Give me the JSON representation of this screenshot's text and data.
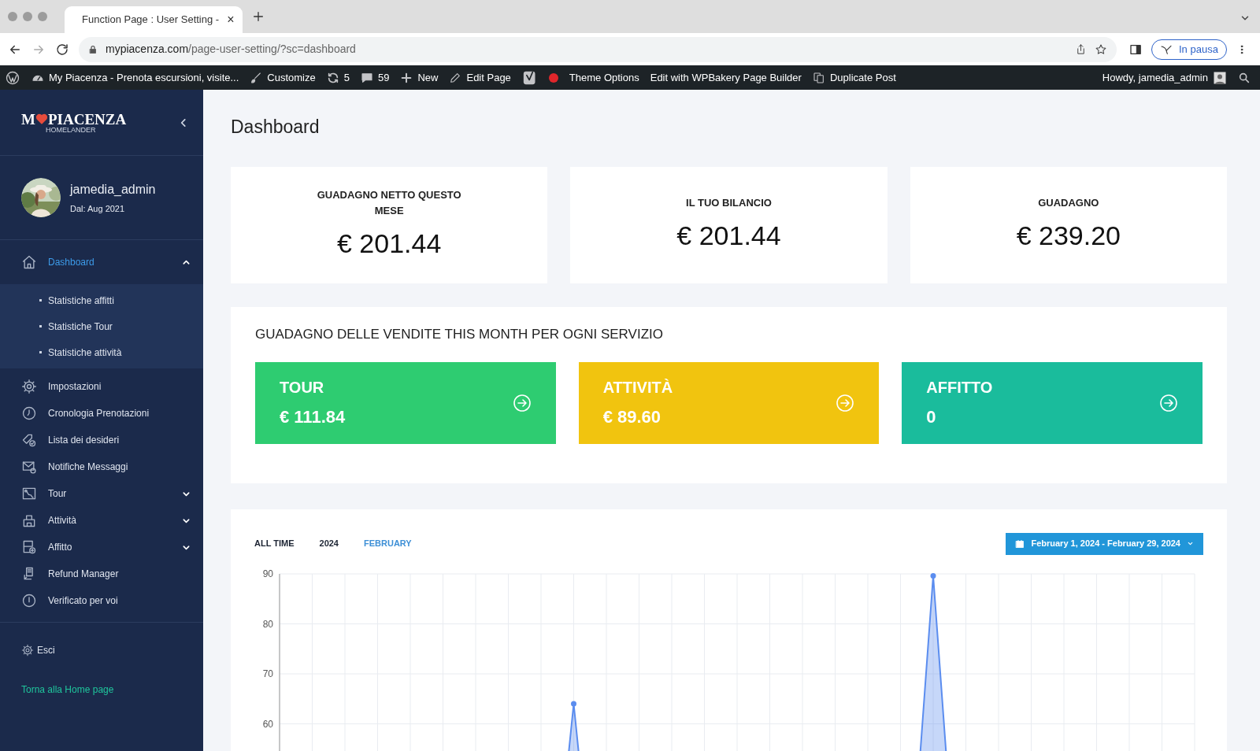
{
  "browser": {
    "tab_title": "Function Page : User Setting -",
    "url_domain": "mypiacenza.com",
    "url_path": "/page-user-setting/?sc=dashboard",
    "tab_close": "×",
    "profile": "In pausa"
  },
  "admin_bar": {
    "items": [
      {
        "kind": "wp"
      },
      {
        "kind": "site",
        "label": "My Piacenza - Prenota escursioni, visite..."
      },
      {
        "kind": "customize",
        "label": "Customize"
      },
      {
        "kind": "updates",
        "label": "5"
      },
      {
        "kind": "comments",
        "label": "59"
      },
      {
        "kind": "new",
        "label": "New"
      },
      {
        "kind": "edit",
        "label": "Edit Page"
      },
      {
        "kind": "seo"
      },
      {
        "kind": "dot",
        "color": "#e0262b"
      },
      {
        "kind": "text",
        "label": "Theme Options"
      },
      {
        "kind": "text",
        "label": "Edit with WPBakery Page Builder"
      },
      {
        "kind": "duplicate",
        "label": "Duplicate Post"
      }
    ],
    "greeting": "Howdy, jamedia_admin"
  },
  "sidebar": {
    "logo": {
      "left": "M",
      "right": "PIACENZA",
      "sub": "HOMELANDER"
    },
    "user": {
      "name": "jamedia_admin",
      "since": "Dal: Aug 2021"
    },
    "menu": [
      {
        "label": "Dashboard",
        "kind": "home",
        "selected": true,
        "expanded": true,
        "children": [
          {
            "label": "Statistiche affitti"
          },
          {
            "label": "Statistiche Tour"
          },
          {
            "label": "Statistiche attività"
          }
        ]
      },
      {
        "label": "Impostazioni",
        "kind": "gear",
        "selected": false
      },
      {
        "label": "Cronologia Prenotazioni",
        "kind": "clock",
        "selected": false
      },
      {
        "label": "Lista dei desideri",
        "kind": "tag",
        "selected": false
      },
      {
        "label": "Notifiche Messaggi",
        "kind": "mail",
        "selected": false
      },
      {
        "label": "Tour",
        "kind": "map",
        "selected": false,
        "expanded": false
      },
      {
        "label": "Attività",
        "kind": "building",
        "selected": false,
        "expanded": false
      },
      {
        "label": "Affitto",
        "kind": "rent",
        "selected": false,
        "expanded": false
      },
      {
        "label": "Refund Manager",
        "kind": "refund",
        "selected": false
      },
      {
        "label": "Verificato per voi",
        "kind": "info",
        "selected": false
      }
    ],
    "logout": "Esci",
    "home_link": "Torna alla Home page"
  },
  "main": {
    "title": "Dashboard",
    "stats": [
      {
        "label": "GUADAGNO NETTO QUESTO MESE",
        "value": "€ 201.44"
      },
      {
        "label": "IL TUO BILANCIO",
        "value": "€ 201.44"
      },
      {
        "label": "GUADAGNO",
        "value": "€ 239.20"
      }
    ],
    "services_title": "GUADAGNO DELLE VENDITE THIS MONTH PER OGNI SERVIZIO",
    "services": [
      {
        "label": "TOUR",
        "value": "€ 111.84",
        "color": "#2ecc71"
      },
      {
        "label": "ATTIVITÀ",
        "value": "€ 89.60",
        "color": "#f1c40f"
      },
      {
        "label": "AFFITTO",
        "value": "0",
        "color": "#1abc9c"
      }
    ],
    "periods": [
      {
        "label": "ALL TIME",
        "selected": false
      },
      {
        "label": "2024",
        "selected": false
      },
      {
        "label": "FEBRUARY",
        "selected": true
      }
    ],
    "date_range": "February 1, 2024 - February 29, 2024",
    "chart_data": {
      "type": "area",
      "ylim": [
        0,
        90
      ],
      "yticks": [
        60,
        70,
        80,
        90
      ],
      "grid": true,
      "series": [
        {
          "color": "#5b8def",
          "values": [
            0,
            0,
            0,
            0,
            0,
            0,
            0,
            0,
            0,
            64,
            0,
            0,
            0,
            0,
            0,
            0,
            0,
            0,
            0,
            0,
            89.6,
            0,
            0,
            0,
            0,
            0,
            0,
            0,
            0
          ]
        }
      ]
    }
  }
}
